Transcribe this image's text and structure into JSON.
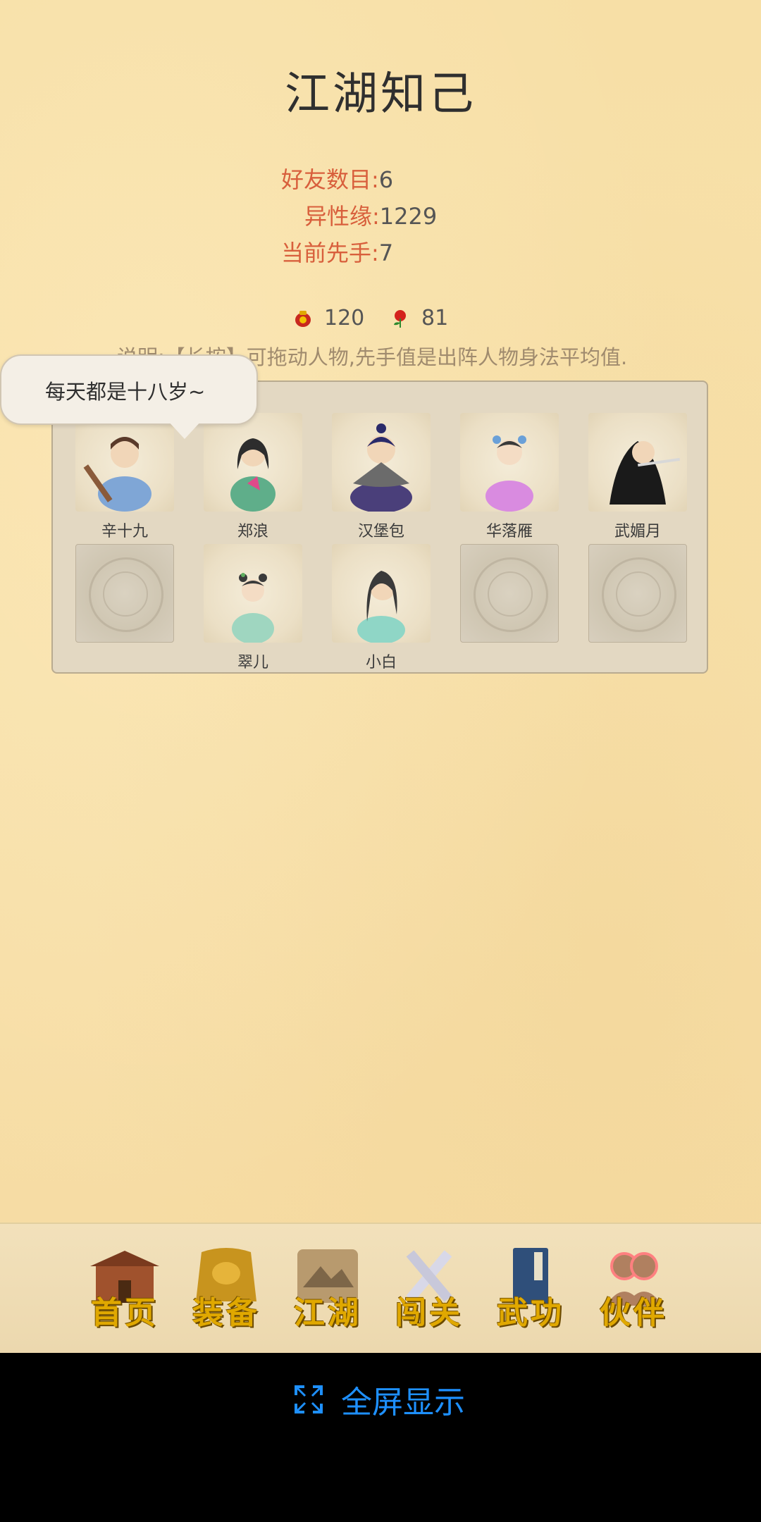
{
  "title": "江湖知己",
  "stats": {
    "friends_label": "好友数目:",
    "friends_value": "6",
    "charm_label": "异性缘:",
    "charm_value": "1229",
    "initiative_label": "当前先手:",
    "initiative_value": "7"
  },
  "resources": [
    {
      "icon": "wine-jar-icon",
      "value": "120"
    },
    {
      "icon": "rose-icon",
      "value": "81"
    }
  ],
  "note": "说明:【长按】可拖动人物,先手值是出阵人物身法平均值.",
  "bubble_text": "每天都是十八岁~",
  "party_slots": [
    {
      "name": "辛十九",
      "empty": false
    },
    {
      "name": "郑浪",
      "empty": false
    },
    {
      "name": "汉堡包",
      "empty": false
    },
    {
      "name": "华落雁",
      "empty": false
    },
    {
      "name": "武媚月",
      "empty": false
    },
    {
      "name": "",
      "empty": true
    },
    {
      "name": "翠儿",
      "empty": false
    },
    {
      "name": "小白",
      "empty": false
    },
    {
      "name": "",
      "empty": true
    },
    {
      "name": "",
      "empty": true
    }
  ],
  "nav": [
    {
      "label": "首页",
      "icon": "house-icon",
      "active": false
    },
    {
      "label": "装备",
      "icon": "armor-icon",
      "active": false
    },
    {
      "label": "江湖",
      "icon": "scroll-map-icon",
      "active": false
    },
    {
      "label": "闯关",
      "icon": "swords-icon",
      "active": false
    },
    {
      "label": "武功",
      "icon": "book-icon",
      "active": false
    },
    {
      "label": "伙伴",
      "icon": "partners-icon",
      "active": true
    }
  ],
  "fullscreen_label": "全屏显示",
  "colors": {
    "accent_red": "#d85f3c",
    "link_blue": "#1e90ff",
    "nav_gold": "#e0a800"
  }
}
